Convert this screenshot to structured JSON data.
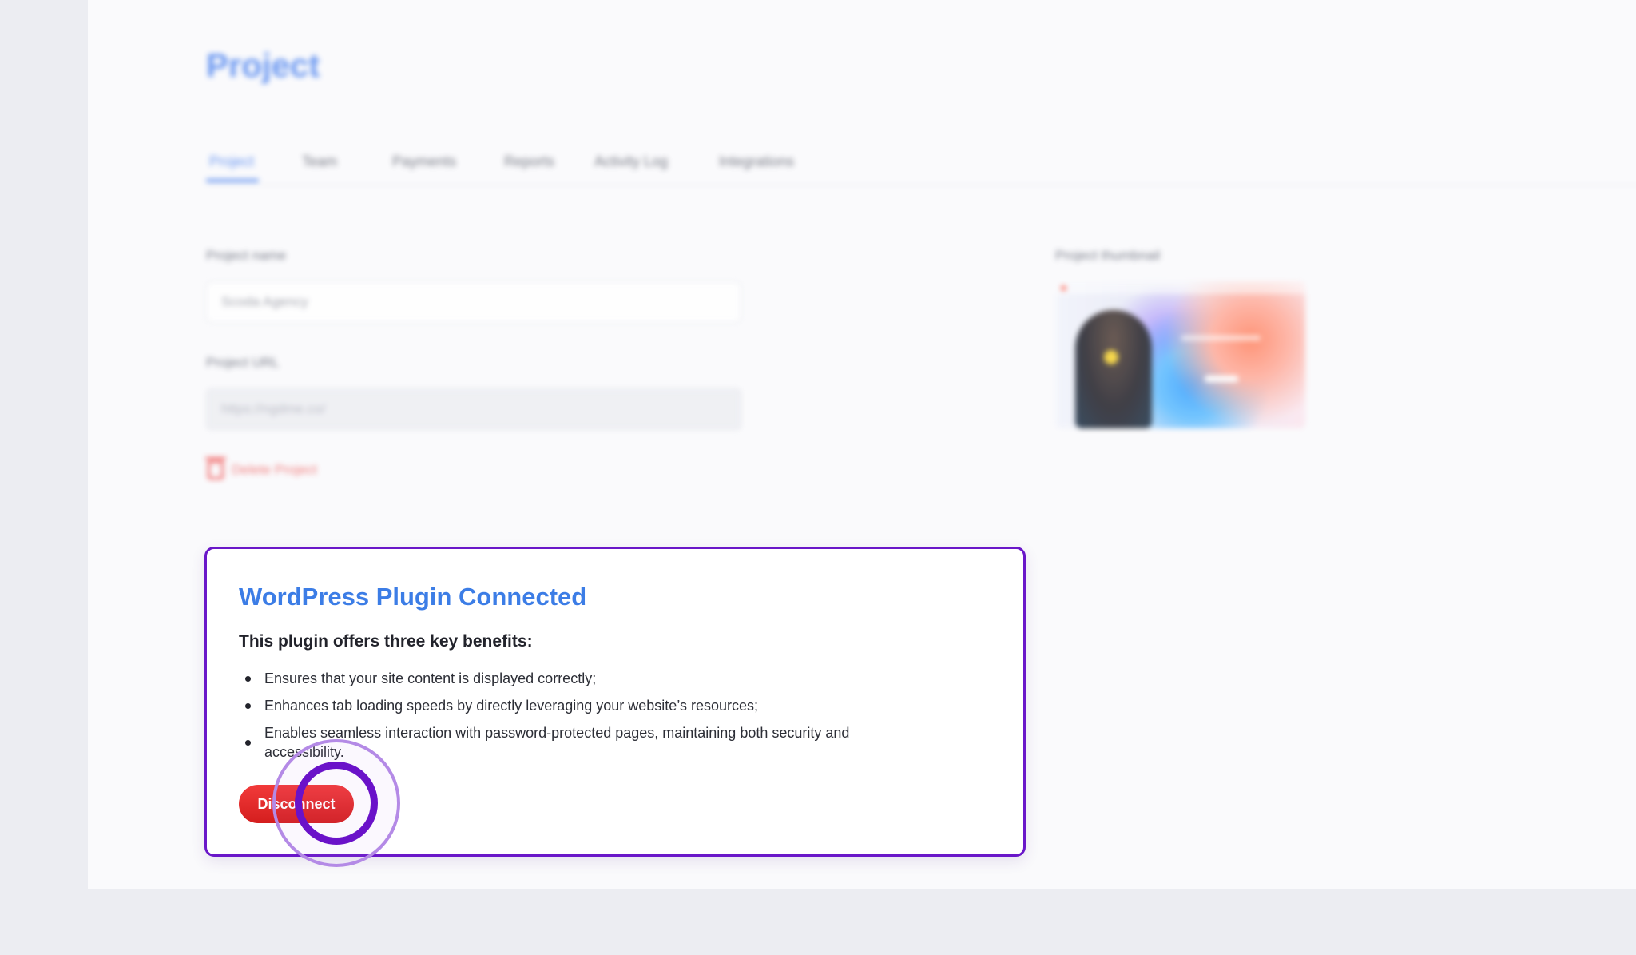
{
  "page": {
    "title": "Project"
  },
  "tabs": [
    {
      "label": "Project",
      "active": true
    },
    {
      "label": "Team",
      "active": false
    },
    {
      "label": "Payments",
      "active": false
    },
    {
      "label": "Reports",
      "active": false
    },
    {
      "label": "Activity Log",
      "active": false
    },
    {
      "label": "Integrations",
      "active": false
    }
  ],
  "form": {
    "project_name_label": "Project name",
    "project_name_value": "Scoda Agency",
    "project_url_label": "Project URL",
    "project_url_value": "https://ngdme.co/",
    "delete_label": "Delete Project",
    "thumbnail_label": "Project thumbnail"
  },
  "card": {
    "title": "WordPress Plugin Connected",
    "subtitle": "This plugin offers three key benefits:",
    "benefits": [
      "Ensures that your site content is displayed correctly;",
      "Enhances tab loading speeds by directly leveraging your website’s resources;",
      "Enables seamless interaction with password-protected pages, maintaining both security and accessibility."
    ],
    "disconnect_label": "Disconnect"
  },
  "colors": {
    "accent": "#3c7de6",
    "card_border": "#6a17c9",
    "danger": "#e12a2a",
    "click_indicator": "#6a12c9"
  },
  "icons": {
    "delete": "trash-icon",
    "click": "click-indicator"
  }
}
